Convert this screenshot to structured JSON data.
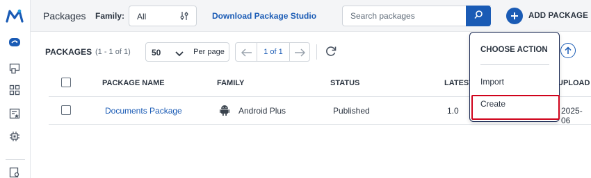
{
  "header": {
    "page_title": "Packages",
    "family_label": "Family:",
    "family_value": "All",
    "download_link": "Download Package Studio",
    "search_placeholder": "Search packages",
    "add_package_label": "ADD PACKAGE"
  },
  "toolbar": {
    "title": "PACKAGES",
    "count": "(1 - 1 of 1)",
    "per_page_value": "50",
    "per_page_label": "Per page",
    "page_indicator": "1 of 1"
  },
  "table": {
    "columns": [
      "PACKAGE NAME",
      "FAMILY",
      "STATUS",
      "LATEST",
      "UPLOAD"
    ],
    "rows": [
      {
        "name": "Documents Package",
        "family": "Android Plus",
        "status": "Published",
        "latest": "1.0",
        "upload": "2025-06"
      }
    ]
  },
  "dropdown": {
    "title": "CHOOSE ACTION",
    "items": [
      "Import",
      "Create"
    ]
  },
  "colors": {
    "accent": "#1a5bb5",
    "highlight": "#d0021b",
    "dropdown_border": "#1c2b55"
  },
  "icons": [
    "app-logo-icon",
    "cloud-sync-icon",
    "devices-icon",
    "grid-icon",
    "star-list-icon",
    "chip-icon",
    "settings-icon",
    "tune-icon",
    "search-icon",
    "plus-icon",
    "chevron-down-icon",
    "arrow-left-icon",
    "arrow-right-icon",
    "refresh-icon",
    "upload-icon",
    "android-icon"
  ]
}
